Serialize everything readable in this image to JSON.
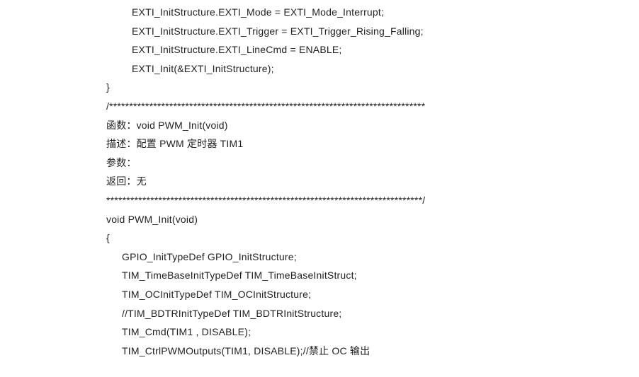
{
  "lines": {
    "l1": "EXTI_InitStructure.EXTI_Mode = EXTI_Mode_Interrupt;",
    "l2": "EXTI_InitStructure.EXTI_Trigger = EXTI_Trigger_Rising_Falling;",
    "l3": "EXTI_InitStructure.EXTI_LineCmd = ENABLE;",
    "l4": "EXTI_Init(&EXTI_InitStructure);",
    "l5": "}",
    "l6": "/*******************************************************************************",
    "l7": "函数：void PWM_Init(void)",
    "l8": "描述：配置 PWM 定时器 TIM1",
    "l9": "参数：",
    "l10": "返回：无",
    "l11": "*******************************************************************************/",
    "l12": "void PWM_Init(void)",
    "l13": "{",
    "l14": "GPIO_InitTypeDef GPIO_InitStructure;",
    "l15": "TIM_TimeBaseInitTypeDef TIM_TimeBaseInitStruct;",
    "l16": "TIM_OCInitTypeDef TIM_OCInitStructure;",
    "l17": "//TIM_BDTRInitTypeDef TIM_BDTRInitStructure;",
    "l18": "TIM_Cmd(TIM1 , DISABLE);",
    "l19": "TIM_CtrlPWMOutputs(TIM1, DISABLE);//禁止 OC 输出"
  }
}
